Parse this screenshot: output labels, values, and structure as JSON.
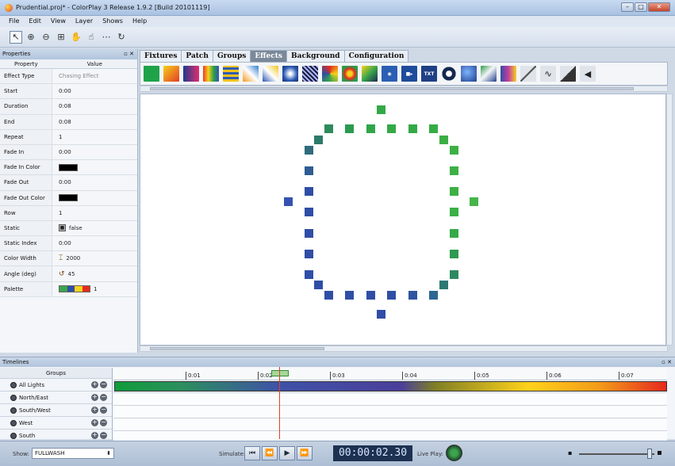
{
  "window": {
    "title": "Prudential.proj* - ColorPlay 3 Release 1.9.2 [Build 20101119]"
  },
  "menu": [
    "File",
    "Edit",
    "View",
    "Layer",
    "Shows",
    "Help"
  ],
  "properties": {
    "panel_title": "Properties",
    "col_property": "Property",
    "col_value": "Value",
    "rows": [
      {
        "name": "Effect Type",
        "value": "Chasing Effect"
      },
      {
        "name": "Start",
        "value": "0:00"
      },
      {
        "name": "Duration",
        "value": "0:08"
      },
      {
        "name": "End",
        "value": "0:08"
      },
      {
        "name": "Repeat",
        "value": "1"
      },
      {
        "name": "Fade In",
        "value": "0:00"
      },
      {
        "name": "Fade In Color",
        "value": ""
      },
      {
        "name": "Fade Out",
        "value": "0:00"
      },
      {
        "name": "Fade Out Color",
        "value": ""
      },
      {
        "name": "Row",
        "value": "1"
      },
      {
        "name": "Static",
        "value": "false"
      },
      {
        "name": "Static Index",
        "value": "0:00"
      },
      {
        "name": "Color Width",
        "value": "2000"
      },
      {
        "name": "Angle (deg)",
        "value": "45"
      },
      {
        "name": "Palette",
        "value": "1"
      }
    ]
  },
  "tabs": [
    "Fixtures",
    "Patch",
    "Groups",
    "Effects",
    "Background",
    "Configuration"
  ],
  "active_tab": "Effects",
  "effects_icons": [
    "solid-green",
    "gradient-orange",
    "gradient-blue",
    "rainbow-bars",
    "stripes",
    "diag-gradient",
    "diag-gradient-2",
    "sparkle",
    "diag-lines",
    "fan",
    "radial",
    "cube",
    "camera",
    "video",
    "txt",
    "ring",
    "globe",
    "photo",
    "bars",
    "line",
    "curve",
    "wedge",
    "more"
  ],
  "fx_text_label": "TXT",
  "timelines": {
    "panel_title": "Timelines",
    "groups_header": "Groups",
    "groups": [
      "All Lights",
      "North/East",
      "South/West",
      "West",
      "South"
    ],
    "ruler_ticks": [
      "0:01",
      "0:02",
      "0:03",
      "0:04",
      "0:05",
      "0:06",
      "0:07"
    ]
  },
  "statusbar": {
    "show_label": "Show:",
    "show_value": "FULLWASH",
    "simulate_label": "Simulate:",
    "timer": "00:00:02.30",
    "live_play_label": "Live Play:"
  }
}
